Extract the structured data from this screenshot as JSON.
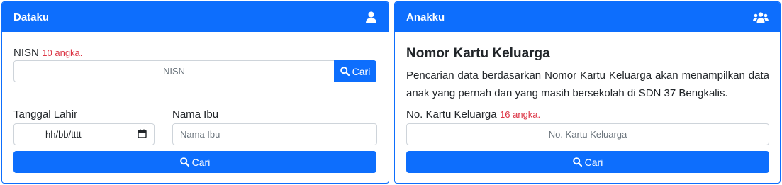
{
  "left_card": {
    "title": "Dataku",
    "icon": "user-icon",
    "nisn_label": "NISN",
    "nisn_hint": "10 angka.",
    "nisn_placeholder": "NISN",
    "nisn_button": "Cari",
    "dob_label": "Tanggal Lahir",
    "dob_placeholder": "hh/bb/tttt",
    "mother_label": "Nama Ibu",
    "mother_placeholder": "Nama Ibu",
    "search_button": "Cari"
  },
  "right_card": {
    "title": "Anakku",
    "icon": "users-icon",
    "heading": "Nomor Kartu Keluarga",
    "description": "Pencarian data berdasarkan Nomor Kartu Keluarga akan menampilkan data anak yang pernah dan yang masih bersekolah di SDN 37 Bengkalis.",
    "kk_label": "No. Kartu Keluarga",
    "kk_hint": "16 angka.",
    "kk_placeholder": "No. Kartu Keluarga",
    "search_button": "Cari"
  },
  "colors": {
    "primary": "#0d6efd",
    "hint": "#dc3545"
  }
}
